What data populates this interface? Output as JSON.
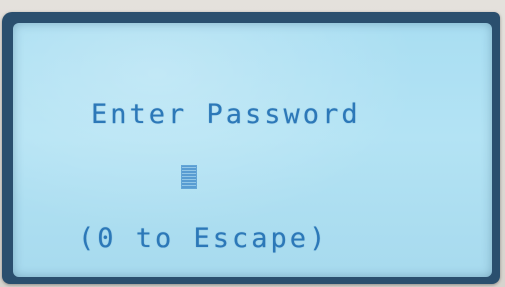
{
  "display": {
    "title": "Enter Password",
    "escape_hint": "(0 to Escape)",
    "password_field": {
      "value": "",
      "cursor": "block-cursor"
    }
  },
  "colors": {
    "lcd_background": "#b0e1f3",
    "lcd_text": "#2c78b8",
    "frame": "#2a4f6e"
  }
}
